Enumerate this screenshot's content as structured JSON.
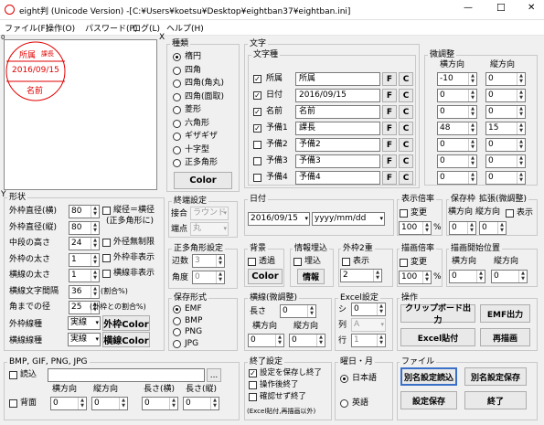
{
  "window": {
    "title": "eight判 (Unicode Version)  -[C:¥Users¥koetsu¥Desktop¥eightban37¥eightban.ini]",
    "minimize": "—",
    "maximize": "☐",
    "close": "✕"
  },
  "menu": [
    "ファイル(F)",
    "操作(O)",
    "パスワード(P)",
    "ログ(L)",
    "ヘルプ(H)"
  ],
  "preview": {
    "org": "所属",
    "title": "課長",
    "date": "2016/09/15",
    "name": "名前",
    "color": "#e00000",
    "x_label": "X",
    "y_label": "Y",
    "origin": "0"
  },
  "shape": {
    "group": "種類",
    "options": [
      "楕円",
      "四角",
      "四角(角丸)",
      "四角(面取)",
      "菱形",
      "六角形",
      "ギザギザ",
      "十字型",
      "正多角形"
    ],
    "selected": 0,
    "color_btn": "Color"
  },
  "text": {
    "group": "文字",
    "sub": "文字種",
    "rows": [
      {
        "label": "所属",
        "checked": true,
        "value": "所属"
      },
      {
        "label": "日付",
        "checked": true,
        "value": "2016/09/15"
      },
      {
        "label": "名前",
        "checked": true,
        "value": "名前"
      },
      {
        "label": "予備1",
        "checked": true,
        "value": "課長"
      },
      {
        "label": "予備2",
        "checked": false,
        "value": "予備2"
      },
      {
        "label": "予備3",
        "checked": false,
        "value": "予備3"
      },
      {
        "label": "予備4",
        "checked": false,
        "value": "予備4"
      }
    ],
    "f": "F",
    "c": "C"
  },
  "fine": {
    "group": "微調整",
    "h": "横方向",
    "v": "縦方向",
    "rows": [
      [
        "-10",
        "0"
      ],
      [
        "0",
        "0"
      ],
      [
        "0",
        "0"
      ],
      [
        "48",
        "15"
      ],
      [
        "0",
        "0"
      ],
      [
        "0",
        "0"
      ],
      [
        "0",
        "0"
      ]
    ]
  },
  "form": {
    "group": "形状",
    "rows": [
      {
        "label": "外枠直径(横)",
        "value": "80"
      },
      {
        "label": "外枠直径(縦)",
        "value": "80"
      },
      {
        "label": "中段の高さ",
        "value": "24"
      },
      {
        "label": "外枠の太さ",
        "value": "1"
      },
      {
        "label": "横線の太さ",
        "value": "1"
      },
      {
        "label": "横線文字間隔",
        "value": "36"
      },
      {
        "label": "角までの径",
        "value": "25"
      }
    ],
    "chk1": "縦径＝横径",
    "chk1b": "(正多角形に)",
    "chk2": "外径無制限",
    "chk3": "外枠非表示",
    "chk4": "横線非表示",
    "note1": "(割合%)",
    "note2": "(外枠との割合%)",
    "line_outer": "外枠線種",
    "line_horiz": "横線線種",
    "line_val": "実線",
    "outer_color": "外枠Color",
    "horiz_color": "横線Color"
  },
  "end": {
    "group": "終端設定",
    "join": "接合",
    "join_val": "ラウンド",
    "cap": "端点",
    "cap_val": "丸"
  },
  "poly": {
    "group": "正多角形設定",
    "sides": "辺数",
    "sides_val": "3",
    "angle": "角度",
    "angle_val": "0"
  },
  "save": {
    "group": "保存形式",
    "options": [
      "EMF",
      "BMP",
      "PNG",
      "JPG"
    ],
    "selected": 0
  },
  "date": {
    "group": "日付",
    "value": "2016/09/15",
    "fmt": "yyyy/mm/dd"
  },
  "bg": {
    "group": "背景",
    "chk": "透過",
    "btn": "Color"
  },
  "info": {
    "group": "情報埋込",
    "chk": "埋込",
    "btn": "情報"
  },
  "dbl": {
    "group": "外枠2重",
    "chk": "表示",
    "value": "2"
  },
  "disp": {
    "group": "表示倍率",
    "chk": "変更",
    "value": "100",
    "unit": "%"
  },
  "pos": {
    "group": "保存枠",
    "group2": "拡張(微調整)",
    "h": "横方向",
    "v": "縦方向",
    "chk": "表示",
    "h_val": "0",
    "v_val": "0"
  },
  "lfine": {
    "group": "横線(微調整)",
    "len": "長さ",
    "len_val": "0",
    "h": "横方向",
    "v": "縦方向",
    "h_val": "0",
    "v_val": "0"
  },
  "excel": {
    "group": "Excel設定",
    "sheet": "シ",
    "sheet_val": "0",
    "col": "列",
    "col_val": "A",
    "row": "行",
    "row_val": "1"
  },
  "draw": {
    "group": "描画倍率",
    "chk": "変更",
    "value": "100",
    "unit": "%"
  },
  "start": {
    "group": "描画開始位置",
    "h": "横方向",
    "v": "縦方向",
    "h_val": "0",
    "v_val": "0"
  },
  "ops": {
    "group": "操作",
    "clip": "クリップボード出力",
    "emf": "EMF出力",
    "excel": "Excel貼付",
    "redraw": "再描画"
  },
  "bmp": {
    "group": "BMP, GIF, PNG, JPG",
    "chk_read": "読込",
    "chk_bg": "背面",
    "browse": "...",
    "h": "横方向",
    "v": "縦方向",
    "lh": "長さ(横)",
    "lv": "長さ(縦)",
    "vals": [
      "0",
      "0",
      "0",
      "0"
    ]
  },
  "exit": {
    "group": "終了設定",
    "opts": [
      "設定を保存し終了",
      "操作後終了",
      "確認せず終了"
    ],
    "checked": [
      true,
      false,
      false
    ],
    "note": "(Excel貼付,再描画以外)"
  },
  "lang": {
    "group": "曜日・月",
    "opts": [
      "日本語",
      "英語"
    ],
    "selected": 0
  },
  "file": {
    "group": "ファイル",
    "saveas_read": "別名設定読込",
    "saveas_save": "別名設定保存",
    "save": "設定保存",
    "quit": "終了"
  }
}
